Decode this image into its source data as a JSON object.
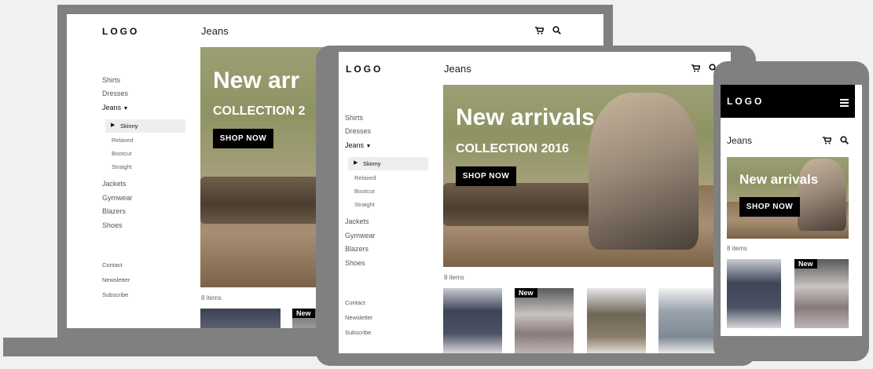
{
  "brand": {
    "logo": "LOGO"
  },
  "page": {
    "title": "Jeans",
    "items_count": "8 items"
  },
  "nav": {
    "shirts": "Shirts",
    "dresses": "Dresses",
    "jeans": "Jeans",
    "skinny": "Skinny",
    "relaxed": "Relaxed",
    "bootcut": "Bootcut",
    "straight": "Straight",
    "jackets": "Jackets",
    "gymwear": "Gymwear",
    "blazers": "Blazers",
    "shoes": "Shoes"
  },
  "footer": {
    "contact": "Contact",
    "newsletter": "Newsletter",
    "subscribe": "Subscribe"
  },
  "hero": {
    "headline_laptop": "New arr",
    "headline": "New arrivals",
    "sub_laptop": "COLLECTION 2",
    "sub": "COLLECTION 2016",
    "button": "SHOP NOW"
  },
  "badge": "New",
  "icons": [
    "cart-icon",
    "search-icon",
    "caret-down-icon",
    "caret-right-icon",
    "hamburger-menu-icon"
  ],
  "colors": {
    "device": "#808080",
    "background": "#f1f1f1",
    "button": "#000000",
    "text": "#333333"
  }
}
